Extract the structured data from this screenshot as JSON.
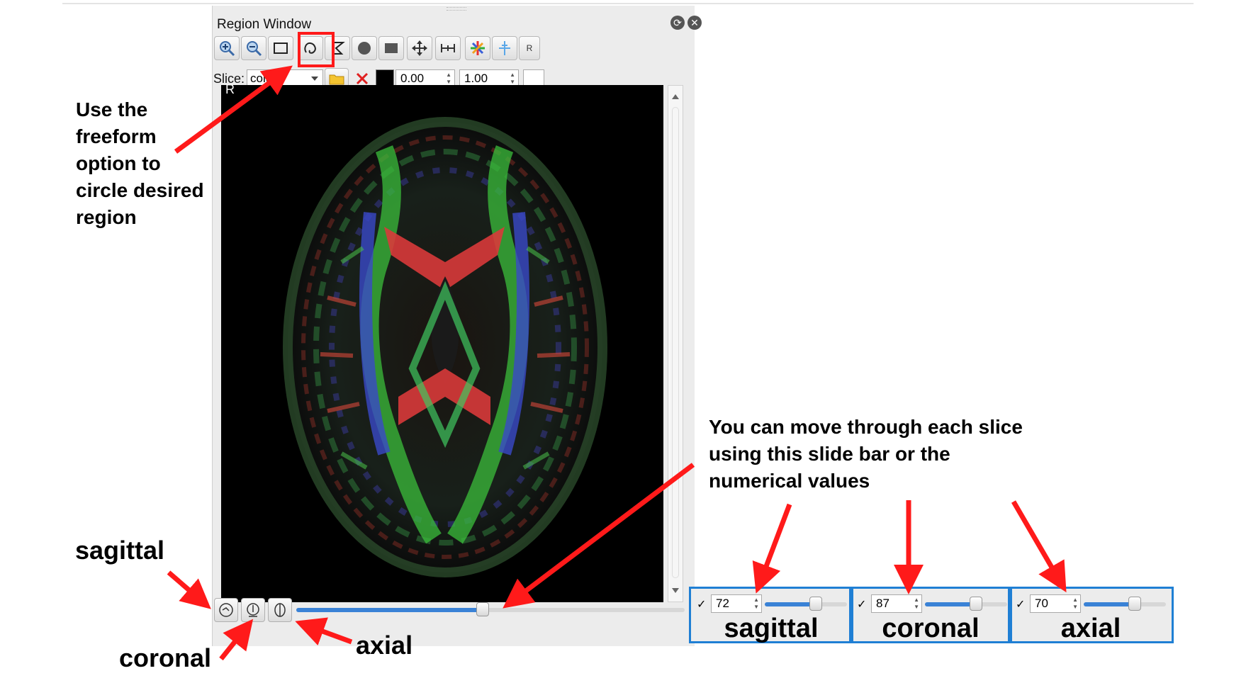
{
  "window": {
    "title": "Region Window",
    "restore_icon": "restore-icon",
    "close_icon": "close-icon"
  },
  "toolbar": {
    "tools": [
      {
        "name": "zoom-in-tool",
        "icon": "zoom-in-icon"
      },
      {
        "name": "zoom-out-tool",
        "icon": "zoom-out-icon"
      },
      {
        "name": "rectangle-outline-tool",
        "icon": "rectangle-outline-icon"
      },
      {
        "name": "freeform-tool",
        "icon": "freeform-lasso-icon"
      },
      {
        "name": "polygon-tool",
        "icon": "polygon-icon"
      },
      {
        "name": "filled-circle-tool",
        "icon": "filled-circle-icon"
      },
      {
        "name": "filled-rectangle-tool",
        "icon": "filled-rectangle-icon"
      },
      {
        "name": "move-tool",
        "icon": "move-arrows-icon"
      },
      {
        "name": "measure-tool",
        "icon": "measure-icon"
      },
      {
        "name": "color-tool",
        "icon": "color-star-icon"
      },
      {
        "name": "crosshair-tool",
        "icon": "crosshair-icon"
      },
      {
        "name": "r-tool",
        "label": "R"
      }
    ],
    "highlighted_tool": "freeform-tool"
  },
  "slice_row": {
    "label": "Slice:",
    "dropdown_value": "colo",
    "folder_icon": "folder-icon",
    "clear_icon": "red-x-icon",
    "color_swatch": "#000000",
    "min_value": "0.00",
    "max_value": "1.00"
  },
  "viewer": {
    "orientation_label": "R",
    "image": "axial DTI color FA brain slice"
  },
  "view_buttons": [
    {
      "name": "sagittal-view-button",
      "icon": "sagittal-head-icon"
    },
    {
      "name": "coronal-view-button",
      "icon": "coronal-head-icon"
    },
    {
      "name": "axial-view-button",
      "icon": "axial-brain-icon"
    }
  ],
  "main_slider": {
    "position": 0.48
  },
  "annotations": {
    "freeform_note": [
      "Use the",
      "freeform",
      "option to",
      "circle desired",
      "region"
    ],
    "slice_note": [
      "You can move through each slice",
      "using this slide bar or the",
      "numerical values"
    ],
    "sagittal": "sagittal",
    "coronal": "coronal",
    "axial": "axial"
  },
  "slice_controls": [
    {
      "checked": "✓",
      "value": "72",
      "slider": 0.62,
      "label": "sagittal"
    },
    {
      "checked": "✓",
      "value": "87",
      "slider": 0.62,
      "label": "coronal"
    },
    {
      "checked": "✓",
      "value": "70",
      "slider": 0.62,
      "label": "axial"
    }
  ],
  "colors": {
    "arrow": "#ff1a1a",
    "highlight": "#ff1a1a",
    "box_border": "#1f7fd4",
    "slider_fill": "#3a82d6"
  }
}
